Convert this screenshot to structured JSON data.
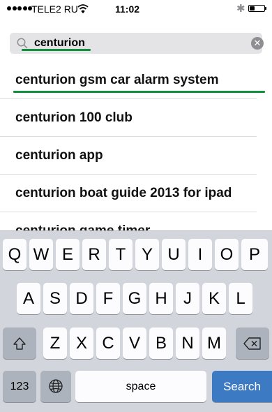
{
  "status_bar": {
    "carrier": "TELE2 RU",
    "time": "11:02",
    "battery_level": 0.35
  },
  "search": {
    "query": "centurion",
    "clear_icon": "clear-icon"
  },
  "suggestions": [
    "centurion gsm car alarm system",
    "centurion 100 club",
    "centurion app",
    "centurion boat guide 2013 for ipad",
    "centurion game timer"
  ],
  "keyboard": {
    "row1": [
      "Q",
      "W",
      "E",
      "R",
      "T",
      "Y",
      "U",
      "I",
      "O",
      "P"
    ],
    "row2": [
      "A",
      "S",
      "D",
      "F",
      "G",
      "H",
      "J",
      "K",
      "L"
    ],
    "row3": [
      "Z",
      "X",
      "C",
      "V",
      "B",
      "N",
      "M"
    ],
    "numbers_label": "123",
    "space_label": "space",
    "search_label": "Search",
    "icons": {
      "shift": "shift-icon",
      "backspace": "backspace-icon",
      "globe": "globe-icon"
    }
  },
  "colors": {
    "highlight_green": "#11913e",
    "search_key_blue": "#3d7ac4",
    "keyboard_bg": "#d2d5db"
  }
}
